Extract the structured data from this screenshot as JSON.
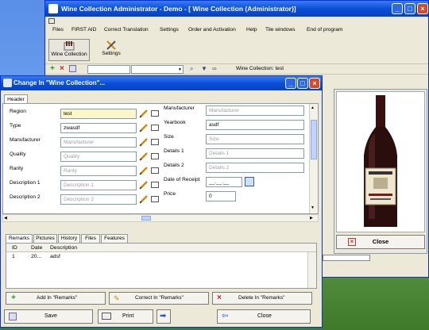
{
  "main_window": {
    "title": "Wine Collection  Administrator - Demo - [      Wine Collection (Administrator)]",
    "menu": [
      "Files",
      "FIRST AID",
      "Correct Translation",
      "Settings",
      "Order and Activation",
      "Help",
      "Tile windows",
      "End of program"
    ],
    "toolbar": {
      "wine_collection": "Wine Collection",
      "settings": "Settings"
    },
    "status_text": "Wine Collection: test"
  },
  "right_panel": {
    "close_label": "Close"
  },
  "dialog": {
    "title": "Change  In \"Wine Collection\"...",
    "tab": "Header",
    "left_fields": [
      {
        "label": "Region",
        "value": "test",
        "placeholder": "",
        "highlight": true
      },
      {
        "label": "Type",
        "value": "zwasdf",
        "placeholder": "",
        "highlight": false
      },
      {
        "label": "Manufacturer",
        "value": "",
        "placeholder": "Manufacturer",
        "highlight": false
      },
      {
        "label": "Quality",
        "value": "",
        "placeholder": "Quality",
        "highlight": false
      },
      {
        "label": "Rarity",
        "value": "",
        "placeholder": "Rarity",
        "highlight": false
      },
      {
        "label": "Description 1",
        "value": "",
        "placeholder": "Description 1",
        "highlight": false
      },
      {
        "label": "Description 2",
        "value": "",
        "placeholder": "Description 2",
        "highlight": false
      }
    ],
    "right_fields": [
      {
        "label": "Manufacturer",
        "value": "",
        "placeholder": "Manufacturer"
      },
      {
        "label": "Yearbook",
        "value": "asdf",
        "placeholder": ""
      },
      {
        "label": "Size",
        "value": "",
        "placeholder": "Size"
      },
      {
        "label": "Details 1",
        "value": "",
        "placeholder": "Details 1"
      },
      {
        "label": "Details 2",
        "value": "",
        "placeholder": "Details 2"
      },
      {
        "label": "Date of Receipt",
        "value": "__.__.__",
        "placeholder": ""
      },
      {
        "label": "Price",
        "value": "0",
        "placeholder": ""
      }
    ],
    "subtabs": [
      "Remarks",
      "Pictures",
      "History",
      "Files",
      "Features"
    ],
    "grid": {
      "columns": [
        "ID",
        "Date",
        "Description"
      ],
      "rows": [
        [
          "1",
          "20...",
          "adsf"
        ]
      ]
    },
    "actions": {
      "add": "Add  In \"Remarks\"",
      "correct": "Correct  In \"Remarks\"",
      "delete": "Delete  In \"Remarks\""
    },
    "bottom": {
      "save": "Save",
      "print": "Print",
      "close": "Close"
    }
  }
}
